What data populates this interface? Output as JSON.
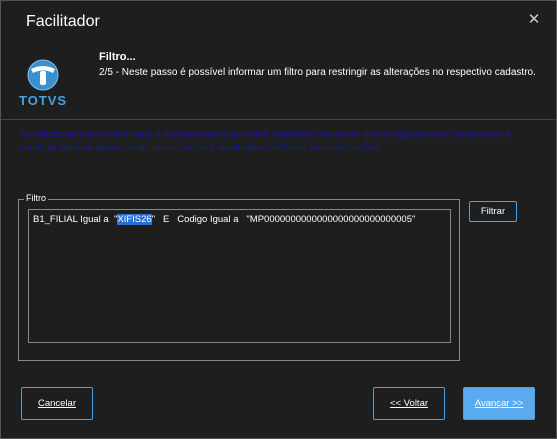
{
  "dialog": {
    "title": "Facilitador",
    "close_icon": "close-icon"
  },
  "header": {
    "logo_text": "TOTVS",
    "step_title": "Filtro...",
    "step_description": "2/5 - Neste passo é possível informar um filtro para restringir as alterações no respectivo cadastro."
  },
  "info": {
    "text": "Ao selecionarmos um filtro para o processamento da rotina, estaremos indicando que os registros que satisfizerem a condição definida abaixo serão processados e atualizados conforme parametrizações."
  },
  "filter": {
    "legend": "Filtro",
    "expr_prefix": "B1_FILIAL Igual a  \"",
    "expr_highlight": "XIFIS26",
    "expr_suffix": "\"   E   Codigo Igual a   \"MP0000000000000000000000000005\"",
    "filter_button": "Filtrar"
  },
  "footer": {
    "cancel_label": "Cancelar",
    "back_label": "<< Voltar",
    "next_label": "Avançar >>"
  },
  "colors": {
    "accent": "#4aa0e0",
    "primary_button": "#5aaaf0",
    "info_text": "#1a1a99",
    "highlight": "#2a6fd6"
  }
}
